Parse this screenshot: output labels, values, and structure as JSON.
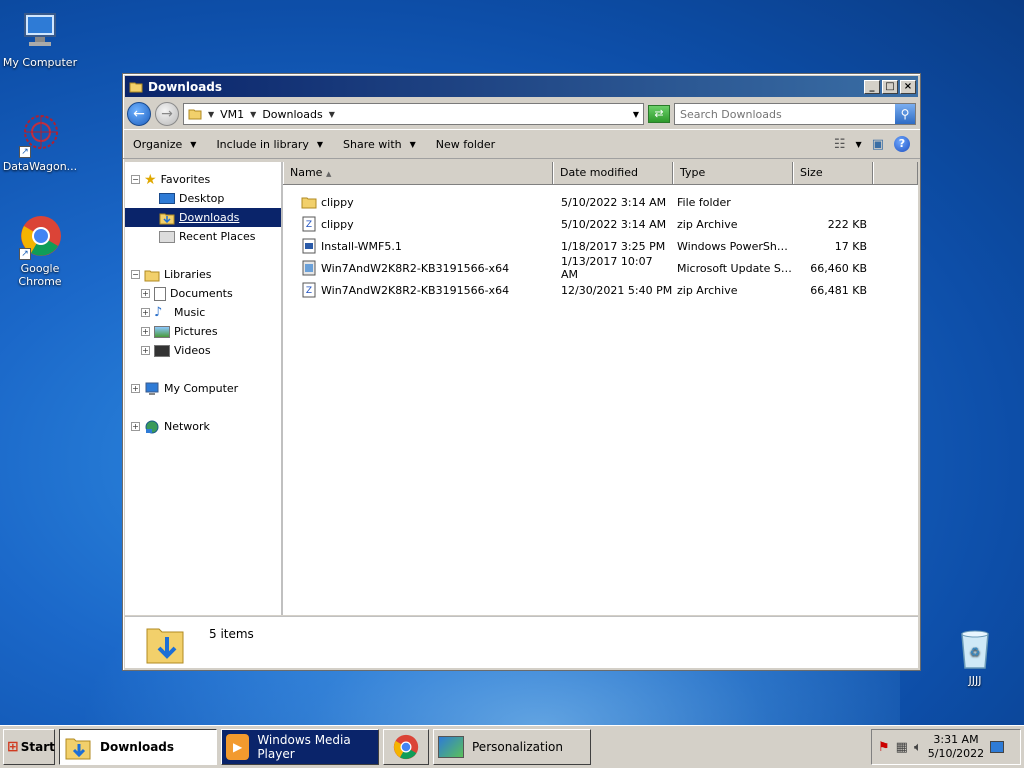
{
  "desktop": {
    "icons": [
      {
        "label": "My Computer"
      },
      {
        "label": "DataWagon..."
      },
      {
        "label": "Google Chrome"
      },
      {
        "label": "JJJJ"
      }
    ]
  },
  "window": {
    "title": "Downloads",
    "breadcrumb": [
      "VM1",
      "Downloads"
    ],
    "search_placeholder": "Search Downloads",
    "toolbar": {
      "organize": "Organize",
      "include": "Include in library",
      "share": "Share with",
      "new_folder": "New folder"
    },
    "nav": {
      "favorites": "Favorites",
      "desktop": "Desktop",
      "downloads": "Downloads",
      "recent": "Recent Places",
      "libraries": "Libraries",
      "documents": "Documents",
      "music": "Music",
      "pictures": "Pictures",
      "videos": "Videos",
      "computer": "My Computer",
      "network": "Network"
    },
    "columns": {
      "name": "Name",
      "date": "Date modified",
      "type": "Type",
      "size": "Size"
    },
    "files": [
      {
        "name": "clippy",
        "date": "5/10/2022 3:14 AM",
        "type": "File folder",
        "size": "",
        "icon": "folder-icon"
      },
      {
        "name": "clippy",
        "date": "5/10/2022 3:14 AM",
        "type": "zip Archive",
        "size": "222 KB",
        "icon": "zip-icon"
      },
      {
        "name": "Install-WMF5.1",
        "date": "1/18/2017 3:25 PM",
        "type": "Windows PowerShel...",
        "size": "17 KB",
        "icon": "powershell-icon"
      },
      {
        "name": "Win7AndW2K8R2-KB3191566-x64",
        "date": "1/13/2017 10:07 AM",
        "type": "Microsoft Update St...",
        "size": "66,460 KB",
        "icon": "msu-icon"
      },
      {
        "name": "Win7AndW2K8R2-KB3191566-x64",
        "date": "12/30/2021 5:40 PM",
        "type": "zip Archive",
        "size": "66,481 KB",
        "icon": "zip-icon"
      }
    ],
    "item_count": "5 items"
  },
  "taskbar": {
    "start": "Start",
    "tasks": [
      "Downloads",
      "Windows Media Player",
      "Personalization"
    ],
    "time": "3:31 AM",
    "date": "5/10/2022"
  },
  "colors": {
    "selection": "#0a246a",
    "titlebar": "#0a246a",
    "chrome": "#d4d0c8"
  }
}
